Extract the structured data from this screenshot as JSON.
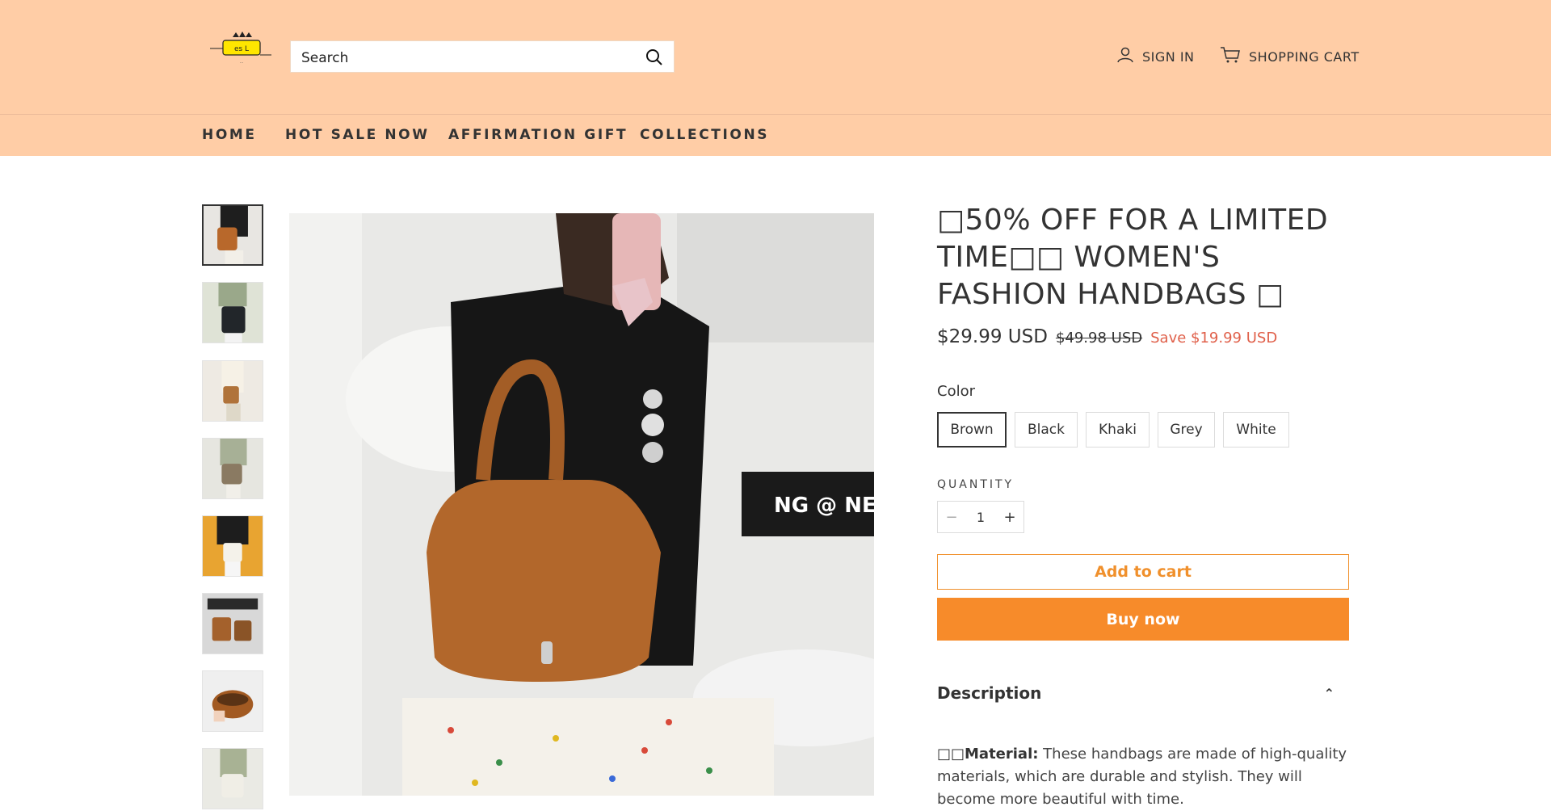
{
  "header": {
    "logo_alt": "Best logo",
    "search_placeholder": "Search",
    "signin_label": "SIGN IN",
    "cart_label": "SHOPPING CART"
  },
  "nav": {
    "items": [
      "HOME",
      "HOT SALE NOW",
      "AFFIRMATION GIFT",
      "COLLECTIONS"
    ]
  },
  "product": {
    "title": "□50% OFF FOR A LIMITED TIME□□ WOMEN'S FASHION HANDBAGS □",
    "price_now": "$29.99 USD",
    "price_old": "$49.98 USD",
    "price_save": "Save $19.99 USD",
    "color_label": "Color",
    "colors": [
      "Brown",
      "Black",
      "Khaki",
      "Grey",
      "White"
    ],
    "selected_color": "Brown",
    "quantity_label": "QUANTITY",
    "quantity": "1",
    "minus": "−",
    "plus": "+",
    "add_to_cart": "Add to cart",
    "buy_now": "Buy now",
    "description_label": "Description",
    "description_icon": "⌃",
    "desc_prefix": "□□",
    "desc_bold": "Material:",
    "desc_text": " These handbags are made of high-quality materials, which are durable and stylish. They will become more beautiful with time."
  },
  "colors": {
    "header_bg": "#ffcda6",
    "accent": "#f78b2a",
    "save": "#e0604a"
  }
}
